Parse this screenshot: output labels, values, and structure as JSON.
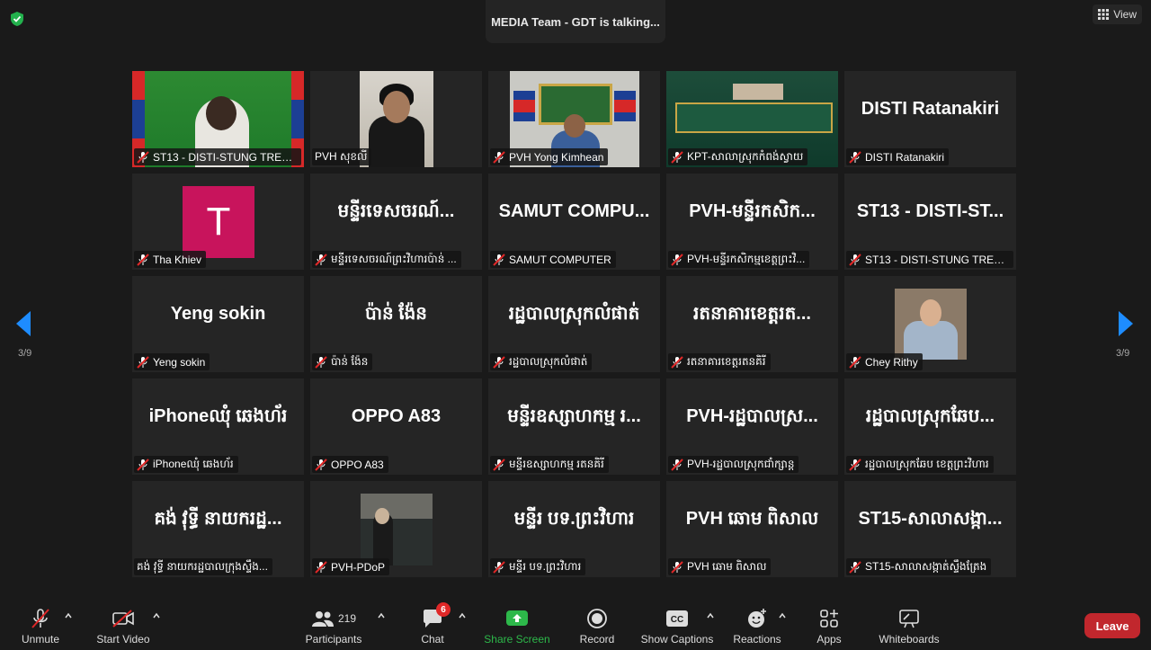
{
  "header": {
    "speaker": "MEDIA Team - GDT is talking...",
    "view_label": "View"
  },
  "pagination": {
    "left_label": "3/9",
    "right_label": "3/9"
  },
  "tiles": [
    {
      "name": "ST13 - DISTI-STUNG TRENG",
      "display": ""
    },
    {
      "name": "PVH សុខលី",
      "display": ""
    },
    {
      "name": "PVH Yong  Kimhean",
      "display": ""
    },
    {
      "name": "KPT-សាលាស្រុកកំពង់ស្វាយ",
      "display": ""
    },
    {
      "name": "DISTI Ratanakiri",
      "display": "DISTI Ratanakiri"
    },
    {
      "name": "Tha Khiev",
      "display": "",
      "avatar_letter": "T"
    },
    {
      "name": "មន្ទីរទេសចរណ៍ព្រះវិហារប៉ាន់ ...",
      "display": "មន្ទីរទេសចរណ៍..."
    },
    {
      "name": "SAMUT COMPUTER",
      "display": "SAMUT  COMPU..."
    },
    {
      "name": "PVH-មន្ទីរកសិកម្មខេត្តព្រះវិ...",
      "display": "PVH-មន្ទីរកសិក..."
    },
    {
      "name": "ST13 - DISTI-STUNG TRENG",
      "display": "ST13  -  DISTI-ST..."
    },
    {
      "name": "Yeng sokin",
      "display": "Yeng sokin"
    },
    {
      "name": "ប៉ាន់ ង៉ែន",
      "display": "ប៉ាន់ ង៉ែន"
    },
    {
      "name": "រដ្ឋបាលស្រុកលំផាត់",
      "display": "រដ្ឋបាលស្រុកលំផាត់"
    },
    {
      "name": "រតនាគារខេត្តរតនគិរី",
      "display": "រតនាគារខេត្តរត..."
    },
    {
      "name": "Chey Rithy",
      "display": ""
    },
    {
      "name": "iPhoneឈុំ ឆេងហ័រ",
      "display": "iPhoneឈុំ ឆេងហ័រ"
    },
    {
      "name": "OPPO A83",
      "display": "OPPO A83"
    },
    {
      "name": "មន្ទីរឧស្សាហកម្ម រតនគិរី",
      "display": "មន្ទីរឧស្សាហកម្ម រ..."
    },
    {
      "name": "PVH-រដ្ឋបាលស្រុកជាំក្សាន្ត",
      "display": "PVH-រដ្ឋបាលស្រ..."
    },
    {
      "name": "រដ្ឋបាលស្រុកឆែប ខេត្តព្រះវិហារ",
      "display": "រដ្ឋបាលស្រុកឆែប..."
    },
    {
      "name": "គង់ វុទ្ធី នាយករដ្ឋបាលក្រុងស្ទឹង...",
      "display": "គង់ វុទ្ធី នាយករដ្ឋ..."
    },
    {
      "name": "PVH-PDoP",
      "display": ""
    },
    {
      "name": "មន្ទីរ បទ.ព្រះវិហារ",
      "display": "មន្ទីរ បទ.ព្រះវិហារ"
    },
    {
      "name": "PVH ឆោម ពិសាល",
      "display": "PVH ឆោម ពិសាល"
    },
    {
      "name": "ST15-សាលាសង្កាត់ស្ទឹងត្រែង",
      "display": "ST15-សាលាសង្កា..."
    }
  ],
  "toolbar": {
    "unmute": "Unmute",
    "start_video": "Start Video",
    "participants": "Participants",
    "participants_count": "219",
    "chat": "Chat",
    "chat_badge": "6",
    "share_screen": "Share Screen",
    "record": "Record",
    "show_captions": "Show Captions",
    "reactions": "Reactions",
    "apps": "Apps",
    "whiteboards": "Whiteboards",
    "leave": "Leave"
  },
  "colors": {
    "share_green": "#2db84a",
    "leave_red": "#c1272d",
    "avatar_pink": "#c8145c",
    "badge_red": "#e02828"
  }
}
